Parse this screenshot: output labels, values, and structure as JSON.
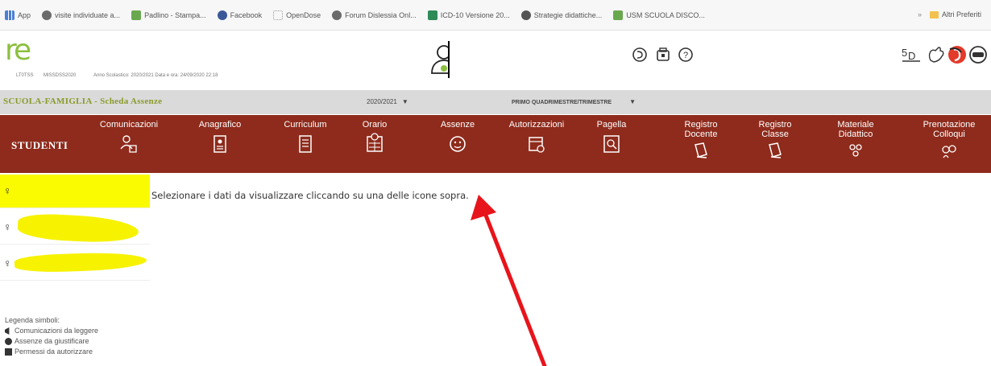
{
  "bookmarks": [
    {
      "label": "App",
      "color": "#4a7fd6"
    },
    {
      "label": "visite individuate a...",
      "color": "#5a5a5a"
    },
    {
      "label": "Padlino - Stampa...",
      "color": "#6aa84f"
    },
    {
      "label": "Facebook",
      "color": "#3b5998"
    },
    {
      "label": "OpenDose",
      "color": "#9a9a9a"
    },
    {
      "label": "Forum Dislessia Onl...",
      "color": "#5a5a5a"
    },
    {
      "label": "ICD-10 Versione 20...",
      "color": "#2e8b57"
    },
    {
      "label": "Strategie didattiche...",
      "color": "#555555"
    },
    {
      "label": "USM SCUOLA DISCO...",
      "color": "#6aa84f"
    }
  ],
  "bookmarks_other": "Altri Preferiti",
  "header": {
    "logo_text": "re",
    "school_code": "LT0TSS",
    "school_code2": "MISSDSS2020",
    "school_year": "Anno Scolastico: 2020/2021   Data e ora: 24/09/2020 22:18"
  },
  "greybar": {
    "title": "SCUOLA-FAMIGLIA - Scheda Assenze",
    "year": "2020/2021",
    "period": "PRIMO QUADRIMESTRE/TRIMESTRE"
  },
  "navbar": {
    "studenti": "STUDENTI",
    "items": [
      {
        "line1": "Comunicazioni",
        "line2": ""
      },
      {
        "line1": "Anagrafico",
        "line2": ""
      },
      {
        "line1": "Curriculum",
        "line2": ""
      },
      {
        "line1": "Orario",
        "line2": ""
      },
      {
        "line1": "Assenze",
        "line2": ""
      },
      {
        "line1": "Autorizzazioni",
        "line2": ""
      },
      {
        "line1": "Pagella",
        "line2": ""
      },
      {
        "line1": "Registro",
        "line2": "Docente"
      },
      {
        "line1": "Registro",
        "line2": "Classe"
      },
      {
        "line1": "Materiale",
        "line2": "Didattico"
      },
      {
        "line1": "Prenotazione",
        "line2": "Colloqui"
      }
    ]
  },
  "students": [
    {
      "gender": "♀"
    },
    {
      "gender": "♀"
    },
    {
      "gender": "♀"
    }
  ],
  "message": "Selezionare i dati da visualizzare cliccando su una delle icone sopra.",
  "legend": {
    "title": "Legenda simboli:",
    "items": [
      "Comunicazioni da leggere",
      "Assenze da giustificare",
      "Permessi da autorizzare"
    ]
  },
  "colors": {
    "navbar": "#8e2b1c",
    "logo": "#8cbf3f",
    "highlight": "#fafa00",
    "arrow": "#e8141b"
  }
}
